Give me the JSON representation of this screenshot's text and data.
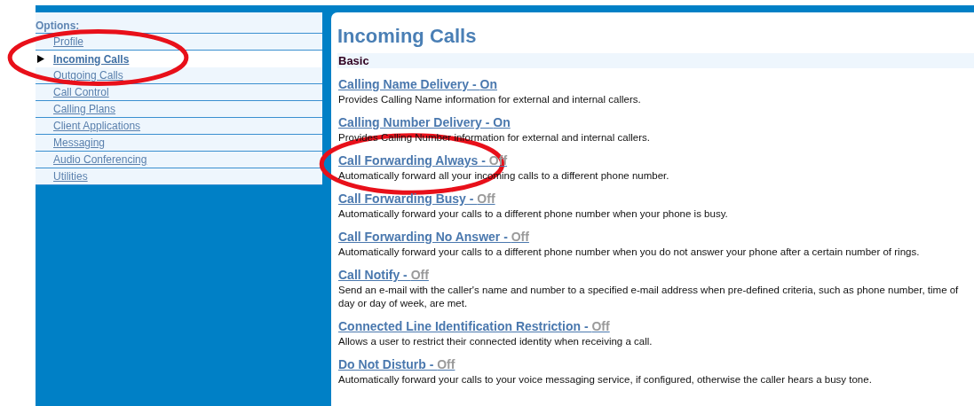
{
  "sidebar": {
    "heading": "Options:",
    "items": [
      {
        "label": "Profile",
        "selected": false,
        "circled": false
      },
      {
        "label": "Incoming Calls",
        "selected": true,
        "circled": true
      },
      {
        "label": "Outgoing Calls",
        "selected": false,
        "circled": false
      },
      {
        "label": "Call Control",
        "selected": false,
        "circled": false
      },
      {
        "label": "Calling Plans",
        "selected": false,
        "circled": false
      },
      {
        "label": "Client Applications",
        "selected": false,
        "circled": false
      },
      {
        "label": "Messaging",
        "selected": false,
        "circled": false
      },
      {
        "label": "Audio Conferencing",
        "selected": false,
        "circled": false
      },
      {
        "label": "Utilities",
        "selected": false,
        "circled": false
      }
    ]
  },
  "main": {
    "title": "Incoming Calls",
    "section": "Basic",
    "features": [
      {
        "name": "Calling Name Delivery -",
        "status": "On",
        "on": true,
        "circled": false,
        "description": "Provides Calling Name information for external and internal callers."
      },
      {
        "name": "Calling Number Delivery -",
        "status": "On",
        "on": true,
        "circled": false,
        "description": "Provides Calling Number information for external and internal callers."
      },
      {
        "name": "Call Forwarding Always -",
        "status": "Off",
        "on": false,
        "circled": true,
        "description": "Automatically forward all your incoming calls to a different phone number."
      },
      {
        "name": "Call Forwarding Busy -",
        "status": "Off",
        "on": false,
        "circled": false,
        "description": "Automatically forward your calls to a different phone number when your phone is busy."
      },
      {
        "name": "Call Forwarding No Answer -",
        "status": "Off",
        "on": false,
        "circled": false,
        "description": "Automatically forward your calls to a different phone number when you do not answer your phone after a certain number of rings."
      },
      {
        "name": "Call Notify -",
        "status": "Off",
        "on": false,
        "circled": false,
        "description": "Send an e-mail with the caller's name and number to a specified e-mail address when pre-defined criteria, such as phone number, time of day or day of week, are met."
      },
      {
        "name": "Connected Line Identification Restriction -",
        "status": "Off",
        "on": false,
        "circled": false,
        "description": "Allows a user to restrict their connected identity when receiving a call."
      },
      {
        "name": "Do Not Disturb -",
        "status": "Off",
        "on": false,
        "circled": false,
        "description": "Automatically forward your calls to your voice messaging service, if configured, otherwise the caller hears a busy tone."
      }
    ]
  }
}
